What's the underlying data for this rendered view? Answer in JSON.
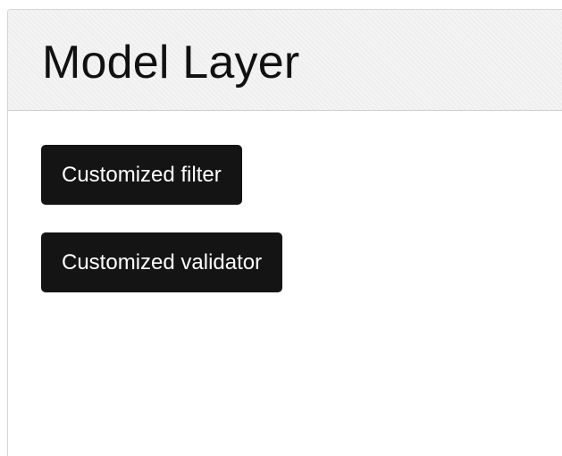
{
  "panel": {
    "title": "Model Layer"
  },
  "buttons": {
    "filter_label": "Customized filter",
    "validator_label": "Customized validator"
  },
  "colors": {
    "button_bg": "#141414",
    "button_text": "#ffffff",
    "header_bg": "#efefef",
    "title_text": "#111111"
  }
}
